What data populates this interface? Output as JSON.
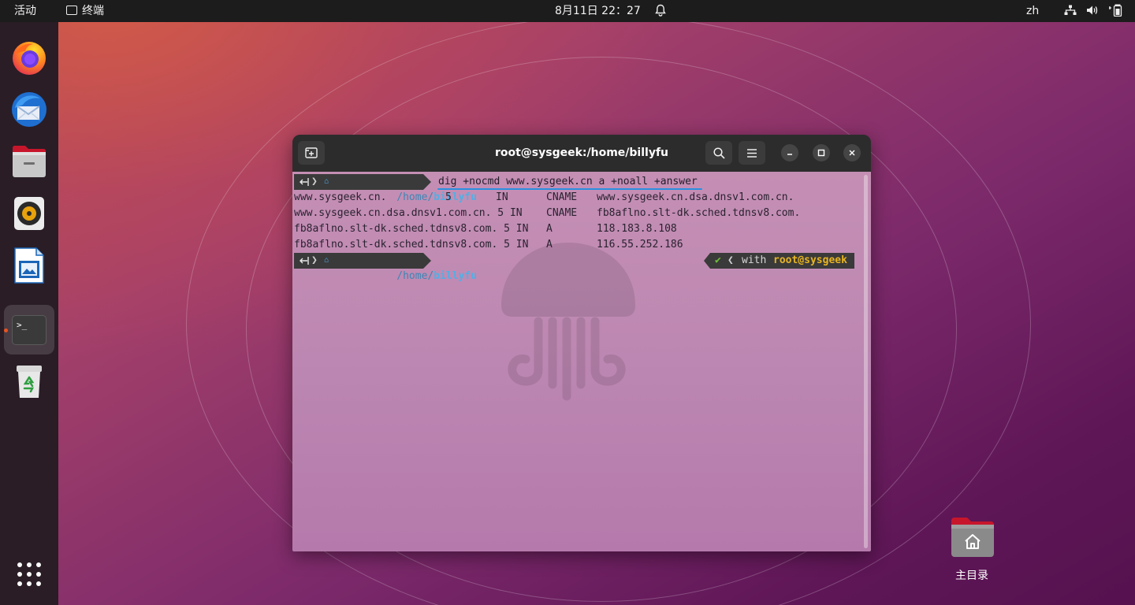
{
  "topbar": {
    "activities": "活动",
    "app_name": "终端",
    "clock": "8月11日  22：27",
    "input_method": "zh"
  },
  "dock": {
    "items": [
      {
        "name": "Firefox",
        "icon": "firefox-icon"
      },
      {
        "name": "Thunderbird",
        "icon": "thunderbird-icon"
      },
      {
        "name": "Files",
        "icon": "files-icon"
      },
      {
        "name": "Rhythmbox",
        "icon": "rhythmbox-icon"
      },
      {
        "name": "LibreOffice Writer",
        "icon": "writer-icon"
      },
      {
        "name": "Terminal",
        "icon": "terminal-icon"
      },
      {
        "name": "Trash",
        "icon": "trash-icon"
      },
      {
        "name": "Show Applications",
        "icon": "app-grid-icon"
      }
    ],
    "terminal_glyph": ">_"
  },
  "window": {
    "title": "root@sysgeek:/home/billyfu"
  },
  "terminal": {
    "prompt_path_dir": "/home/",
    "prompt_path_user": "billyfu",
    "command": "dig +nocmd www.sysgeek.cn a +noall +answer",
    "rows": [
      [
        "www.sysgeek.cn.",
        "5",
        "IN",
        "CNAME",
        "www.sysgeek.cn.dsa.dnsv1.com.cn."
      ],
      [
        "www.sysgeek.cn.dsa.dnsv1.com.cn.",
        "5",
        "IN",
        "CNAME",
        "fb8aflno.slt-dk.sched.tdnsv8.com."
      ],
      [
        "fb8aflno.slt-dk.sched.tdnsv8.com.",
        "5",
        "IN",
        "A",
        "118.183.8.108"
      ],
      [
        "fb8aflno.slt-dk.sched.tdnsv8.com.",
        "5",
        "IN",
        "A",
        "116.55.252.186"
      ]
    ],
    "right_prompt_with": "with",
    "right_prompt_user": "root@sysgeek"
  },
  "desktop": {
    "home_label": "主目录"
  },
  "colors": {
    "ubuntu_orange": "#e95420",
    "path_blue": "#4fb0e6",
    "user_yellow": "#e6b422",
    "check_green": "#6fbf3a"
  }
}
